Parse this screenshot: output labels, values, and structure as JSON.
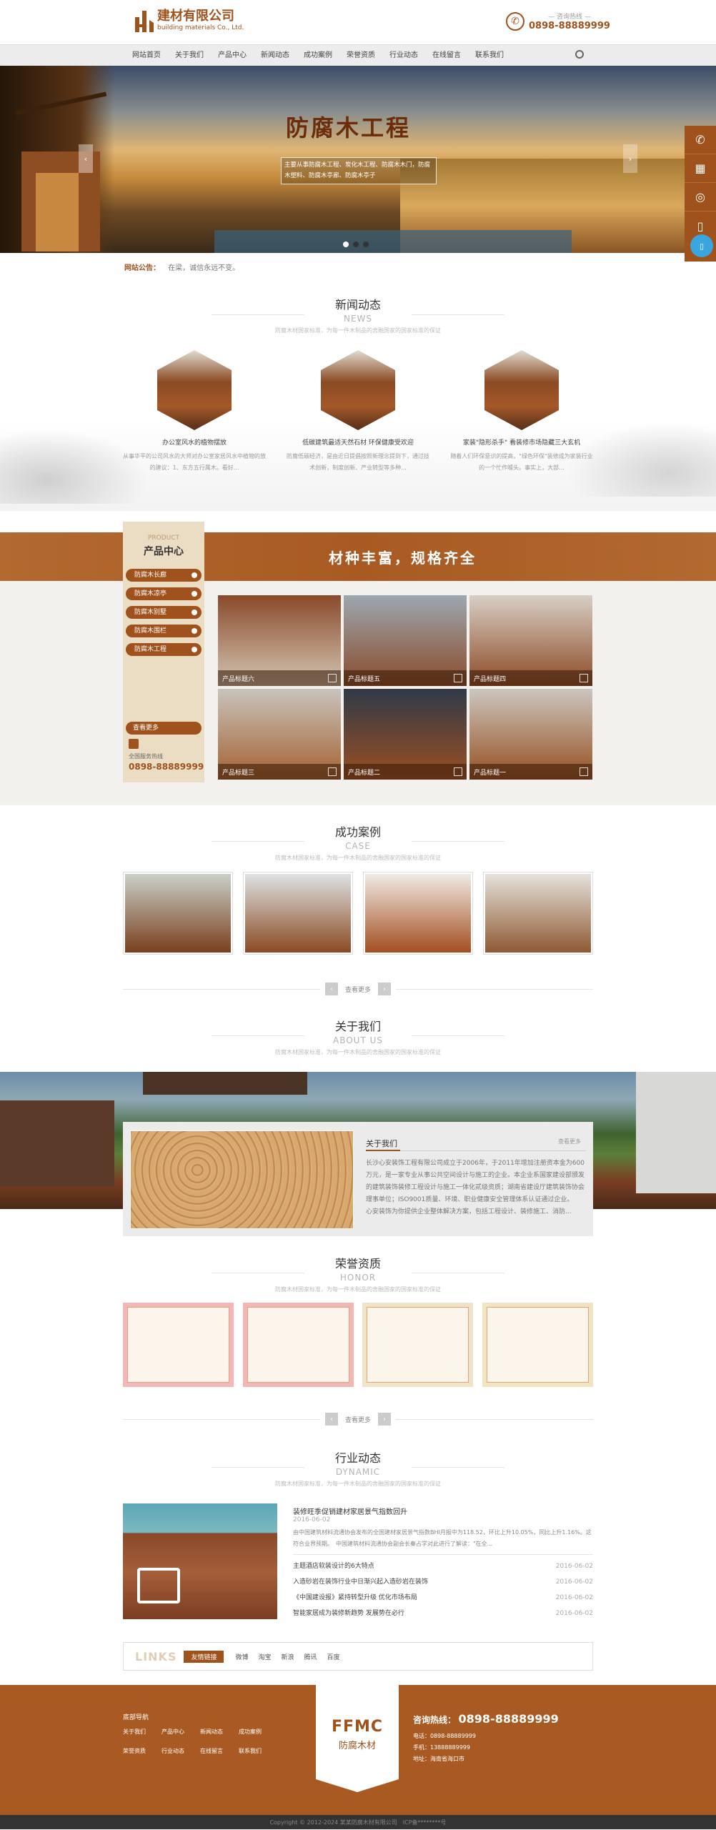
{
  "header": {
    "company": "建材有限公司",
    "company_en": "building materials Co., Ltd.",
    "hotline_label": "— 咨询热线 —",
    "hotline": "0898-88889999"
  },
  "nav": [
    "网站首页",
    "关于我们",
    "产品中心",
    "新闻动态",
    "成功案例",
    "荣誉资质",
    "行业动态",
    "在线留言",
    "联系我们"
  ],
  "banner": {
    "title": "防腐木工程",
    "text": "主要从事防腐木工程、炭化木工程、防腐木木门，防腐木塑料、防腐木亭廊、防腐木亭子"
  },
  "notice": {
    "label": "网站公告：",
    "text": "在梁，诚信永远不变。"
  },
  "news": {
    "title": "新闻动态",
    "en": "NEWS",
    "sub": "防腐木材国家标准，为每一件木制品的舍融国家的国家标准的保证",
    "items": [
      {
        "title": "办公室风水的植物摆放",
        "desc": "从事华平的公司风水的大师对办公室家居风水中植物的放的建议：1、东方五行属木。看好..."
      },
      {
        "title": "低碳建筑最适天然石材 环保健康受欢迎",
        "desc": "防腐低碳经济，是由近日提倡按照新理念提到下，通过技术创新，制度创新、产业转型等多种..."
      },
      {
        "title": "家装\"隐形杀手\" 看装修市场隐藏三大玄机",
        "desc": "随着人们环保意识的提高，\"绿色环保\"装修成为家装行业的一个忙作噱头。事实上，大部..."
      }
    ]
  },
  "products": {
    "side_en": "PRODUCT",
    "side_cn": "产品中心",
    "cats": [
      "防腐木长廊",
      "防腐木凉亭",
      "防腐木别墅",
      "防腐木围栏",
      "防腐木工程"
    ],
    "more": "查看更多",
    "phone_label": "全国服务热线",
    "phone": "0898-88889999",
    "slogan": "材种丰富，规格齐全",
    "items": [
      "产品标题六",
      "产品标题五",
      "产品标题四",
      "产品标题三",
      "产品标题二",
      "产品标题一"
    ]
  },
  "cases": {
    "title": "成功案例",
    "en": "CASE",
    "sub": "防腐木材国家标准，为每一件木制品的舍融国家的国家标准的保证",
    "more": "查看更多"
  },
  "about": {
    "title": "关于我们",
    "en": "ABOUT US",
    "sub": "防腐木材国家标准，为每一件木制品的舍融国家的国家标准的保证",
    "box_title": "关于我们",
    "more": "查看更多",
    "text": "长沙心安装饰工程有限公司成立于2006年，于2011年增加注册资本金为600万元，是一家专业从事公共空间设计与施工的企业。本企业系国家建设部颁发的建筑装饰装修工程设计与施工一体化贰级资质；湖南省建设厅建筑装饰协会理事单位；ISO9001质量、环境、职业健康安全管理体系认证通过企业。　　心安装饰为你提供企业整体解决方案，包括工程设计、装修施工、消防..."
  },
  "honor": {
    "title": "荣誉资质",
    "en": "HONOR",
    "sub": "防腐木材国家标准，为每一件木制品的舍融国家的国家标准的保证",
    "more": "查看更多"
  },
  "dynamic": {
    "title": "行业动态",
    "en": "DYNAMIC",
    "sub": "防腐木材国家标准，为每一件木制品的舍融国家的国家标准的保证",
    "top_title": "装修旺季促销建材家居景气指数回升",
    "top_date": "2016-06-02",
    "top_desc": "由中国建筑材料流通协会发布的全国建材家居景气指数BHI月报中为118.52，环比上升10.05%，同比上升1.16%。这符合业界预期。　中国建筑材料流通协会副会长秦占学对此进行了解读：\"在全...",
    "list": [
      {
        "t": "主题酒店软装设计的6大特点",
        "d": "2016-06-02"
      },
      {
        "t": "入造砂岩在装饰行业中日渐兴起入造砂岩在装饰",
        "d": "2016-06-02"
      },
      {
        "t": "《中国建设报》紧持转型升级 优化市场布局",
        "d": "2016-06-02"
      },
      {
        "t": "智能家居成为装修新趋势 发展势在必行",
        "d": "2016-06-02"
      }
    ]
  },
  "links": {
    "label": "LINKS",
    "tag": "友情链接",
    "items": [
      "微博",
      "淘宝",
      "新浪",
      "腾讯",
      "百度"
    ]
  },
  "footer": {
    "nav_title": "底部导航",
    "nav": [
      "关于我们",
      "产品中心",
      "新闻动态",
      "成功案例",
      "荣誉资质",
      "行业动态",
      "在线留言",
      "联系我们"
    ],
    "logo": "FFMC",
    "logo_cn": "防腐木材",
    "hotline_label": "咨询热线：",
    "hotline": "0898-88889999",
    "lines": [
      "电话：0898-88889999",
      "手机：13888889999",
      "地址：海南省海口市"
    ],
    "copyright": "Copyright © 2012-2024 某某防腐木材有限公司　ICP备********号"
  },
  "colors": {
    "brand": "#a0521c",
    "accent": "#c8763a",
    "sidebar_bg": "#ebddc4"
  }
}
